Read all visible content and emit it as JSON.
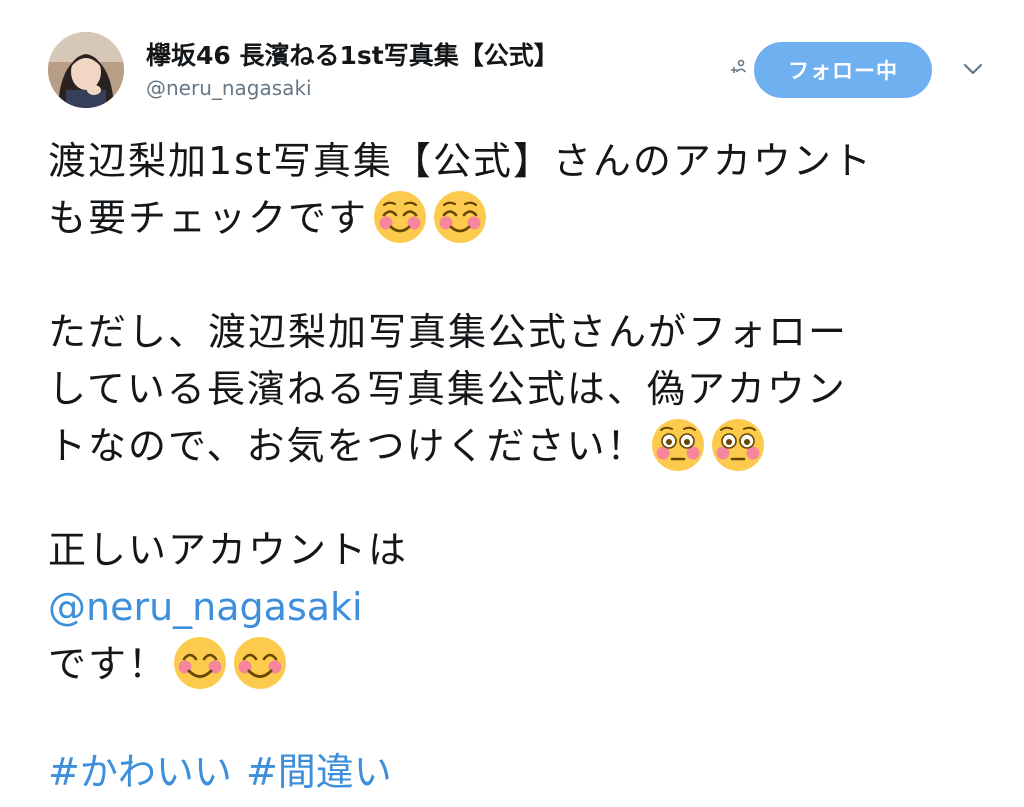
{
  "account": {
    "display_name": "欅坂46 長濱ねる1st写真集【公式】",
    "handle": "@neru_nagasaki",
    "follow_label": "フォロー中"
  },
  "tweet": {
    "line1": "渡辺梨加1st写真集【公式】さんのアカウント",
    "line2": "も要チェックです",
    "line3": "ただし、渡辺梨加写真集公式さんがフォロー",
    "line4": "している長濱ねる写真集公式は、偽アカウン",
    "line5": "トなので、お気をつけください！",
    "line6": "正しいアカウントは",
    "mention": "@neru_nagasaki",
    "line7": "です！",
    "hashtag1": "#かわいい",
    "hashtag2": "#間違い"
  },
  "icons": {
    "follow": "add-user-icon",
    "menu": "chevron-down-icon",
    "emoji_blush": "smiling-face-with-closed-eyes-emoji",
    "emoji_flushed": "flushed-face-emoji",
    "emoji_smile": "smiling-face-with-smiling-eyes-emoji"
  },
  "colors": {
    "follow_button": "#6fb1f0",
    "link": "#3d8fdc",
    "handle": "#657786"
  }
}
